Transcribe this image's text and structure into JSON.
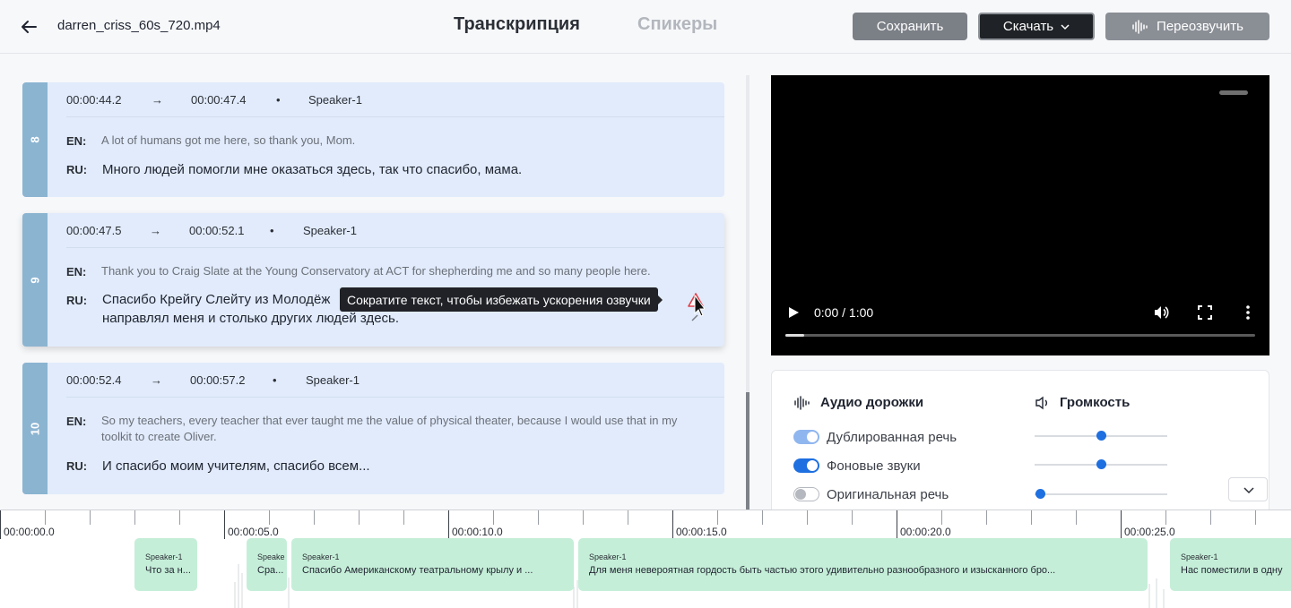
{
  "header": {
    "filename": "darren_criss_60s_720.mp4",
    "tab_transcription": "Транскрипция",
    "tab_speakers": "Спикеры",
    "save_label": "Сохранить",
    "download_label": "Скачать",
    "revoice_label": "Переозвучить"
  },
  "segments": [
    {
      "number": "8",
      "start": "00:00:44.2",
      "arrow": "→",
      "end": "00:00:47.4",
      "dot": "•",
      "speaker": "Speaker-1",
      "en_label": "EN:",
      "en_text": "A lot of humans got me here, so thank you, Mom.",
      "ru_label": "RU:",
      "ru_text": "Много людей помогли мне оказаться здесь, так что спасибо, мама."
    },
    {
      "number": "9",
      "start": "00:00:47.5",
      "arrow": "→",
      "end": "00:00:52.1",
      "dot": "•",
      "speaker": "Speaker-1",
      "en_label": "EN:",
      "en_text": "Thank you to Craig Slate at the Young Conservatory at ACT for shepherding me and so many people here.",
      "ru_label": "RU:",
      "ru_text_line1": "Спасибо Крейгу Слейту из Молодёж",
      "ru_text_line2": "направлял меня и столько других людей здесь."
    },
    {
      "number": "10",
      "start": "00:00:52.4",
      "arrow": "→",
      "end": "00:00:57.2",
      "dot": "•",
      "speaker": "Speaker-1",
      "en_label": "EN:",
      "en_text": "So my teachers, every teacher that ever taught me the value of physical theater, because I would use that in my toolkit to create Oliver.",
      "ru_label": "RU:",
      "ru_text": "И спасибо моим учителям, спасибо всем..."
    }
  ],
  "tooltip": "Сократите текст, чтобы избежать ускорения озвучки",
  "video": {
    "time": "0:00 / 1:00",
    "progress": 0.04
  },
  "audio": {
    "tracks_title": "Аудио дорожки",
    "volume_title": "Громкость",
    "tracks": [
      {
        "label": "Дублированная речь",
        "state": "on-light",
        "volume": 0.5
      },
      {
        "label": "Фоновые звуки",
        "state": "on",
        "volume": 0.5
      },
      {
        "label": "Оригинальная речь",
        "state": "off",
        "volume": 0.04
      }
    ]
  },
  "timeline": {
    "labels": [
      "00:00:00.0",
      "00:00:05.0",
      "00:00:10.0",
      "00:00:15.0",
      "00:00:20.0",
      "00:00:25.0"
    ],
    "blocks": [
      {
        "speaker": "Speaker-1",
        "text": "Что за н..."
      },
      {
        "speaker": "Speake",
        "text": "Сра..."
      },
      {
        "speaker": "Speaker-1",
        "text": "Спасибо Американскому театральному крылу и ..."
      },
      {
        "speaker": "Speaker-1",
        "text": "Для меня невероятная гордость быть частью этого удивительно разнообразного и изысканного бро..."
      },
      {
        "speaker": "Speaker-1",
        "text": "Нас поместили в одну"
      }
    ]
  }
}
